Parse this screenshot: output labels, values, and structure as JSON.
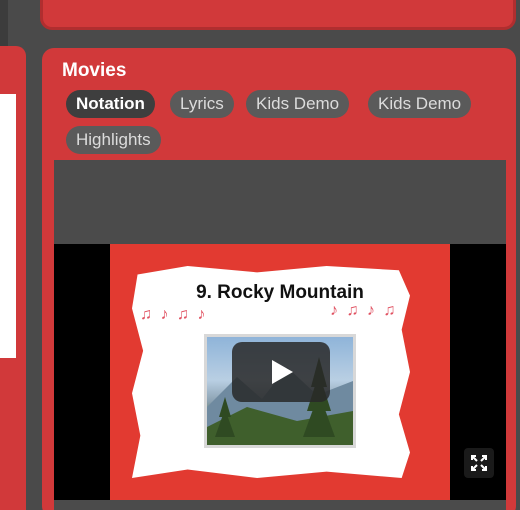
{
  "movies": {
    "title": "Movies",
    "tabs": [
      {
        "label": "Notation",
        "active": true
      },
      {
        "label": "Lyrics",
        "active": false
      },
      {
        "label": "Kids Demo",
        "active": false
      },
      {
        "label": "Kids Demo",
        "active": false
      },
      {
        "label": "Highlights",
        "active": false
      }
    ],
    "video": {
      "thumbnail_title": "9. Rocky Mountain",
      "play_icon": "play-icon",
      "fullscreen_icon": "fullscreen-icon"
    }
  },
  "colors": {
    "card_red": "#d1393a",
    "tab_bg": "#5a5a5a",
    "tab_active_bg": "#3e3e3e",
    "page_bg": "#4a4a4a"
  }
}
